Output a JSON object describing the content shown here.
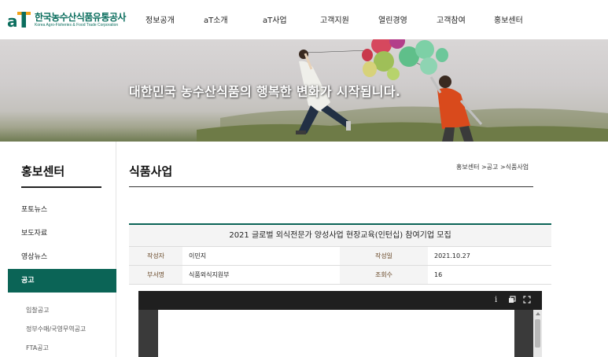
{
  "header": {
    "logo_korean": "한국농수산식품유통공사",
    "logo_english": "Korea Agro-Fisheries & Food Trade Corporation",
    "nav": [
      "정보공개",
      "aT소개",
      "aT사업",
      "고객지원",
      "열린경영",
      "고객참여",
      "홍보센터"
    ]
  },
  "banner": {
    "slogan": "대한민국 농수산식품의 행복한 변화가 시작됩니다."
  },
  "sidebar": {
    "title": "홍보센터",
    "items": [
      {
        "label": "포토뉴스",
        "active": false
      },
      {
        "label": "보도자료",
        "active": false
      },
      {
        "label": "영상뉴스",
        "active": false
      },
      {
        "label": "공고",
        "active": true
      }
    ],
    "sub_items": [
      "입찰공고",
      "정부수매/국영무역공고",
      "FTA공고"
    ]
  },
  "content": {
    "title": "식품사업",
    "breadcrumb": "홍보센터 >공고 >식품사업"
  },
  "post": {
    "title": "2021 글로벌 외식전문가 양성사업 현장교육(인턴십) 참여기업 모집",
    "author_label": "작성자",
    "author": "이민지",
    "date_label": "작성일",
    "date": "2021.10.27",
    "dept_label": "부서명",
    "dept": "식품외식지원부",
    "views_label": "조회수",
    "views": "16"
  },
  "viewer": {
    "icons": [
      "info-icon",
      "open-window-icon",
      "fullscreen-icon"
    ],
    "info_glyph": "i"
  },
  "colors": {
    "brand_green": "#0b6456",
    "logo_green": "#0b6e5e",
    "logo_orange": "#f2a21a"
  }
}
